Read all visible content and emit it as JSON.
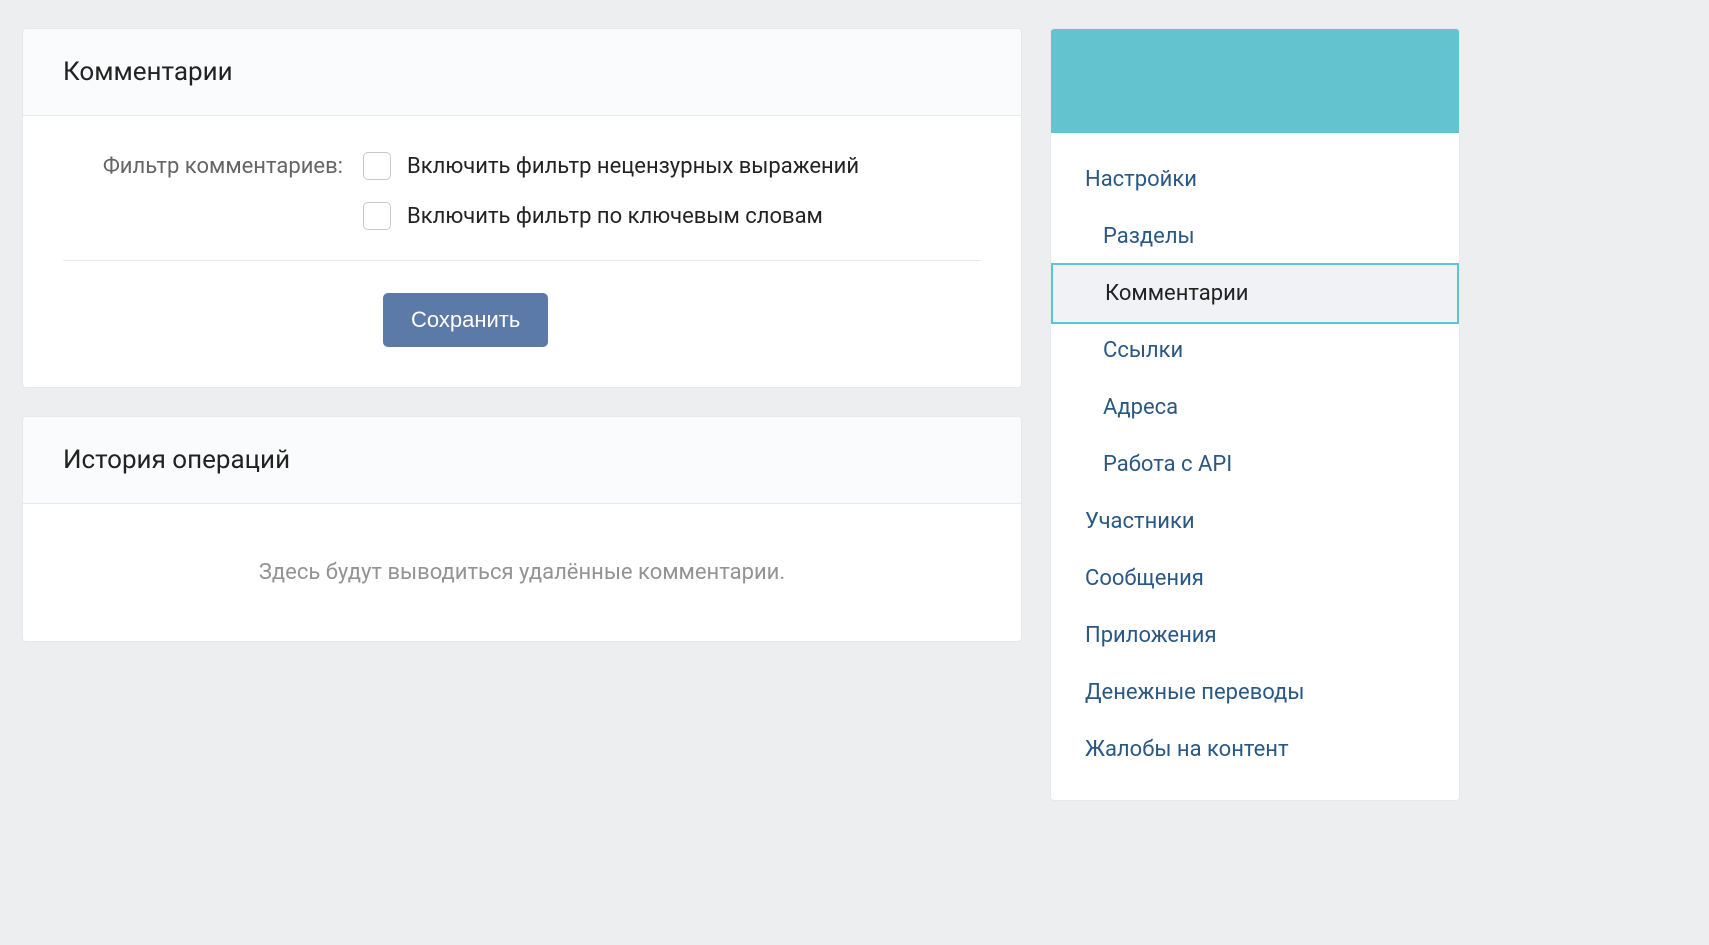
{
  "comments_panel": {
    "title": "Комментарии",
    "filter_label": "Фильтр комментариев:",
    "option_profanity": "Включить фильтр нецензурных выражений",
    "option_keywords": "Включить фильтр по ключевым словам",
    "save_button": "Сохранить"
  },
  "history_panel": {
    "title": "История операций",
    "empty_text": "Здесь будут выводиться удалённые комментарии."
  },
  "sidebar": {
    "items": [
      {
        "label": "Настройки",
        "sub": false,
        "active": false
      },
      {
        "label": "Разделы",
        "sub": true,
        "active": false
      },
      {
        "label": "Комментарии",
        "sub": true,
        "active": true
      },
      {
        "label": "Ссылки",
        "sub": true,
        "active": false
      },
      {
        "label": "Адреса",
        "sub": true,
        "active": false
      },
      {
        "label": "Работа с API",
        "sub": true,
        "active": false
      },
      {
        "label": "Участники",
        "sub": false,
        "active": false
      },
      {
        "label": "Сообщения",
        "sub": false,
        "active": false
      },
      {
        "label": "Приложения",
        "sub": false,
        "active": false
      },
      {
        "label": "Денежные переводы",
        "sub": false,
        "active": false
      },
      {
        "label": "Жалобы на контент",
        "sub": false,
        "active": false
      }
    ]
  }
}
